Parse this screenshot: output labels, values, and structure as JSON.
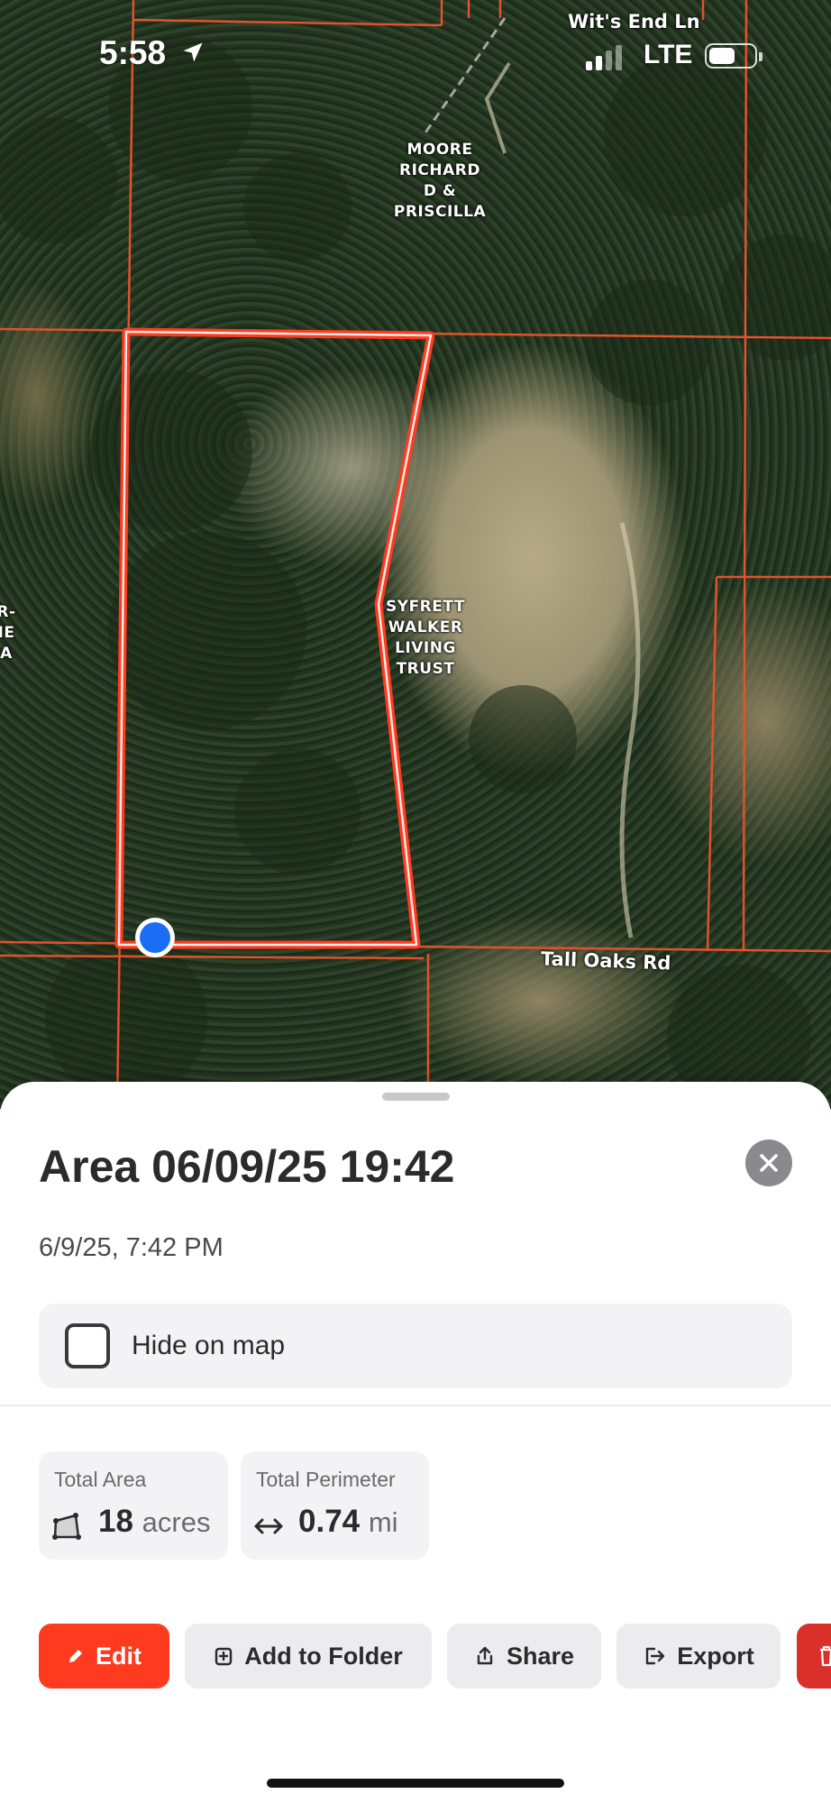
{
  "status_bar": {
    "time": "5:58",
    "network": "LTE",
    "icons": [
      "location-arrow-icon",
      "cellular-signal-icon",
      "battery-icon"
    ]
  },
  "map": {
    "parcel_labels": {
      "north": "MOORE\nRICHARD\nD &\nPRISCILLA",
      "east": "SYFRETT\nWALKER\nLIVING\nTRUST",
      "west_partial": "R-\nIE\nA"
    },
    "road_labels": {
      "top": "Wit's End Ln",
      "bottom": "Tall Oaks Rd"
    },
    "colors": {
      "parcel_line": "#e0532c",
      "area_outline": "#ff3b1f",
      "location_dot": "#1a6ef5"
    }
  },
  "sheet": {
    "title": "Area 06/09/25 19:42",
    "subtitle": "6/9/25, 7:42 PM",
    "hide_on_map": {
      "label": "Hide on map",
      "checked": false
    },
    "stats": {
      "area": {
        "label": "Total Area",
        "value": "18",
        "unit": "acres"
      },
      "perimeter": {
        "label": "Total Perimeter",
        "value": "0.74",
        "unit": "mi"
      }
    },
    "actions": {
      "edit": "Edit",
      "add_to_folder": "Add to Folder",
      "share": "Share",
      "export": "Export"
    },
    "colors": {
      "accent": "#ff3b1f",
      "danger": "#d9312a",
      "close_button": "#8a8a8e"
    }
  }
}
